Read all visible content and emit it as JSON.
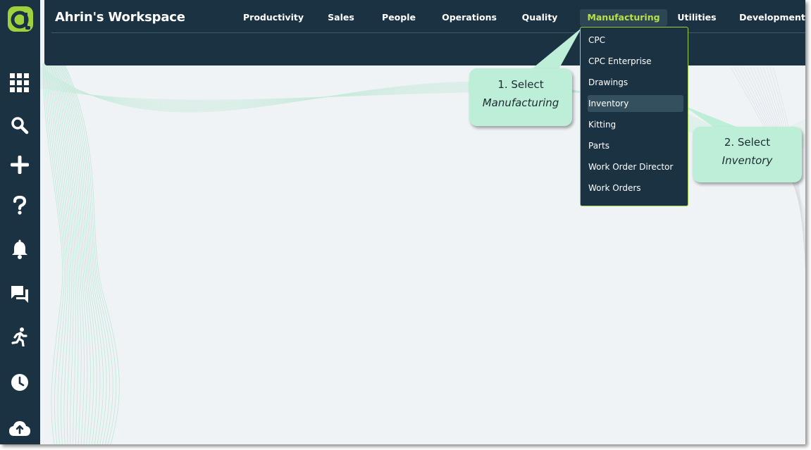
{
  "app": {
    "title": "Ahrin's Workspace"
  },
  "sidebar": {
    "icons": [
      "logo-icon",
      "apps-grid-icon",
      "search-icon",
      "add-icon",
      "help-icon",
      "bell-icon",
      "chat-icon",
      "running-person-icon",
      "clock-icon",
      "cloud-upload-icon"
    ]
  },
  "nav": {
    "items": [
      "Productivity",
      "Sales",
      "People",
      "Operations",
      "Quality",
      "Manufacturing",
      "Utilities",
      "Development"
    ],
    "active": "Manufacturing"
  },
  "dropdown": {
    "items": [
      "CPC",
      "CPC Enterprise",
      "Drawings",
      "Inventory",
      "Kitting",
      "Parts",
      "Work Order Director",
      "Work Orders"
    ],
    "highlighted": "Inventory"
  },
  "callouts": {
    "step1": {
      "line1": "1. Select",
      "line2": "Manufacturing"
    },
    "step2": {
      "line1": "2. Select",
      "line2": "Inventory"
    }
  },
  "colors": {
    "sidebar_bg": "#1a3242",
    "content_bg": "#f0f3f6",
    "accent": "#b8e04a",
    "callout_bg": "#bdeed8"
  }
}
